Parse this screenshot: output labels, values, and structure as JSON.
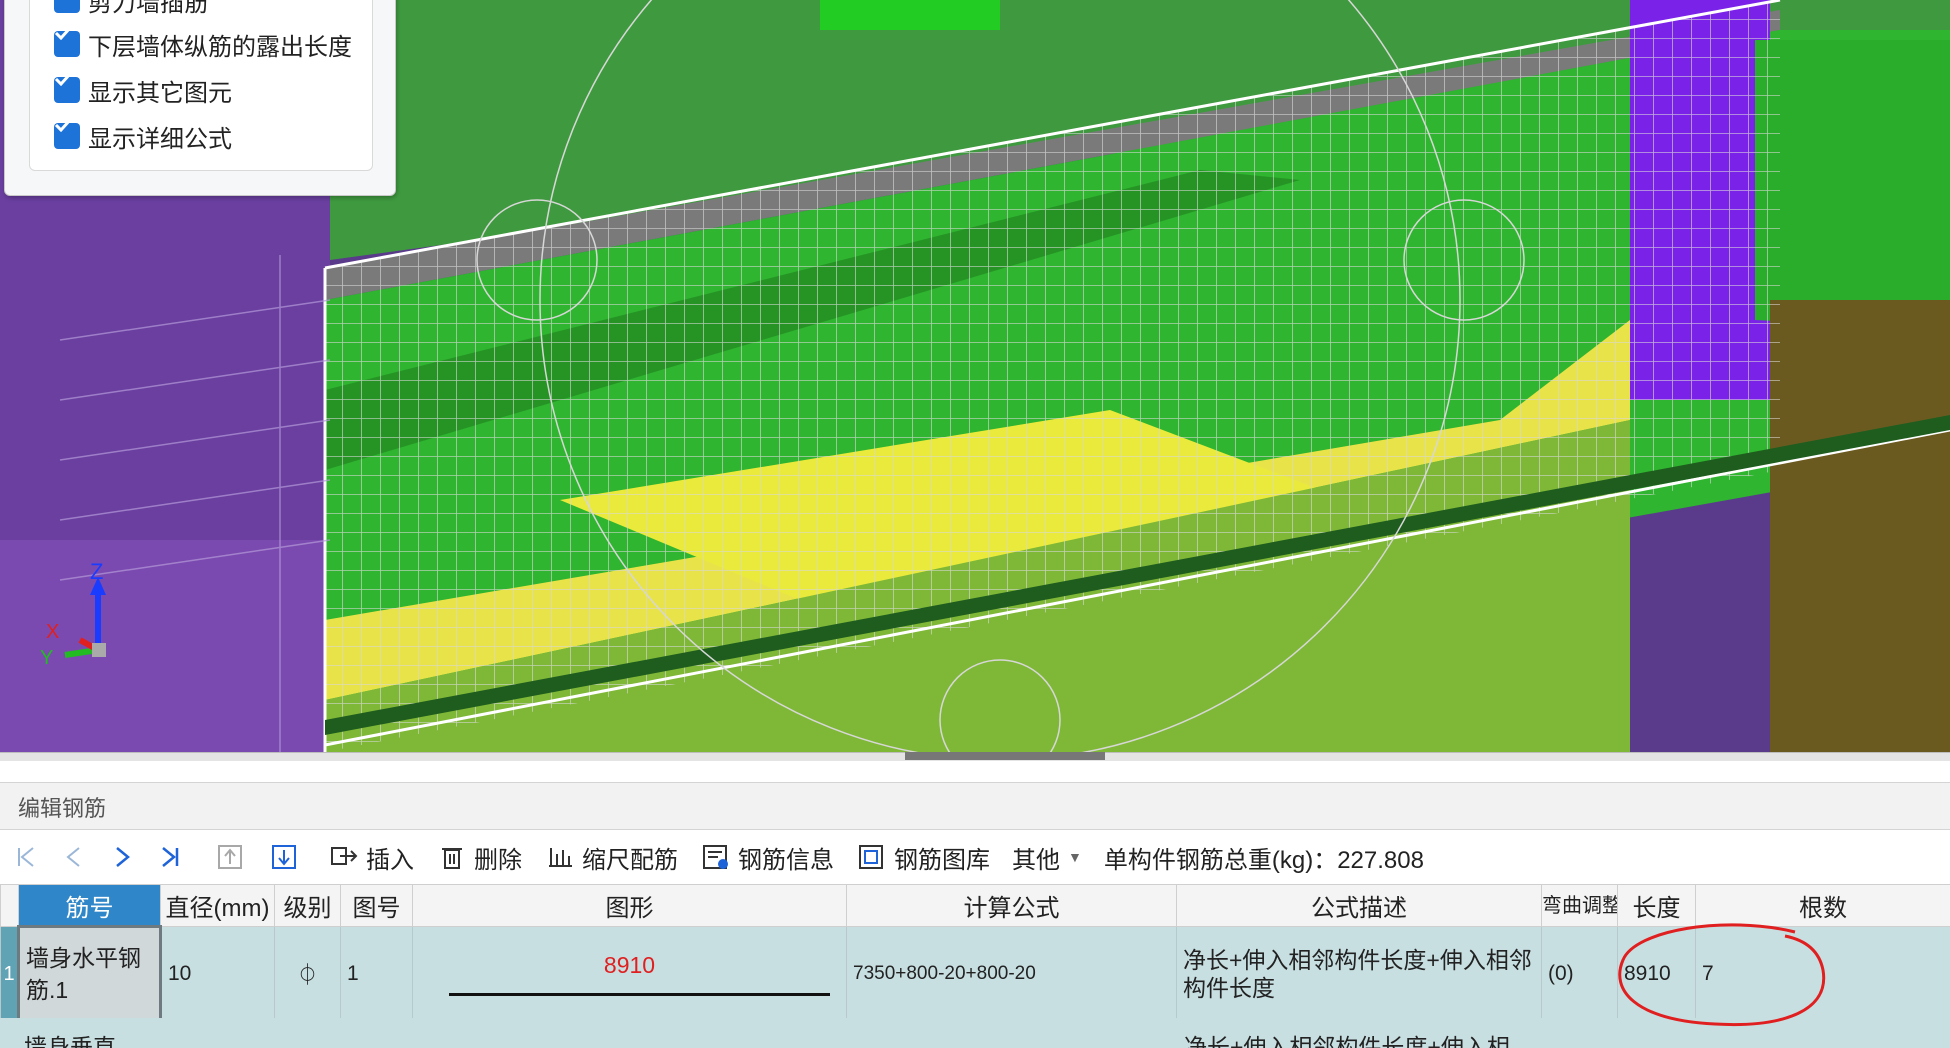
{
  "settings_panel": {
    "options": [
      {
        "label": "剪力墙插筋",
        "checked": true
      },
      {
        "label": "下层墙体纵筋的露出长度",
        "checked": true
      },
      {
        "label": "显示其它图元",
        "checked": true
      },
      {
        "label": "显示详细公式",
        "checked": true
      }
    ]
  },
  "axes": {
    "z": "Z",
    "x": "X",
    "y": "Y"
  },
  "editor": {
    "title": "编辑钢筋"
  },
  "toolbar": {
    "insert_label": "插入",
    "delete_label": "删除",
    "scale_label": "缩尺配筋",
    "info_label": "钢筋信息",
    "library_label": "钢筋图库",
    "other_label": "其他",
    "weight_text": "单构件钢筋总重(kg)：227.808"
  },
  "table": {
    "columns": [
      "筋号",
      "直径(mm)",
      "级别",
      "图号",
      "图形",
      "计算公式",
      "公式描述",
      "弯曲调整",
      "长度",
      "根数"
    ],
    "rows": [
      {
        "num": "1",
        "name": "墙身水平钢筋.1",
        "diameter": "10",
        "grade": "⏀",
        "fig": "1",
        "shape_value": "8910",
        "formula": "7350+800-20+800-20",
        "description": "净长+伸入相邻构件长度+伸入相邻构件长度",
        "bend": "(0)",
        "length": "8910",
        "count": "7"
      }
    ],
    "next_row": {
      "name": "墙身垂直",
      "description": "净长+伸入相邻构件长度+伸入相"
    }
  },
  "colors": {
    "highlight": "#e02020",
    "row_bg": "#c8dfe2",
    "header_active": "#2f86c8"
  }
}
